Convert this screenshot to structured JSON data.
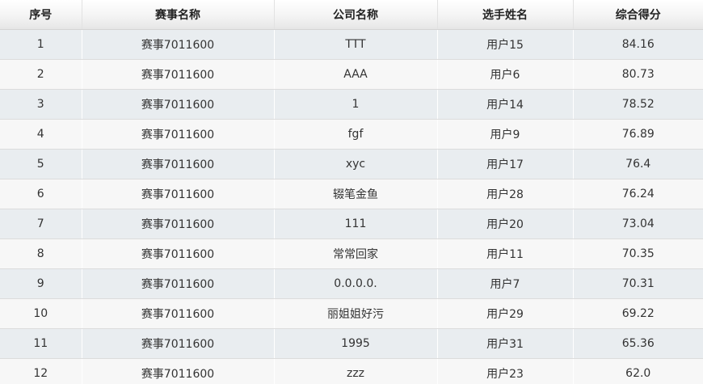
{
  "table": {
    "headers": [
      "序号",
      "赛事名称",
      "公司名称",
      "选手姓名",
      "综合得分"
    ],
    "rows": [
      [
        "1",
        "赛事7011600",
        "TTT",
        "用户15",
        "84.16"
      ],
      [
        "2",
        "赛事7011600",
        "AAA",
        "用户6",
        "80.73"
      ],
      [
        "3",
        "赛事7011600",
        "1",
        "用户14",
        "78.52"
      ],
      [
        "4",
        "赛事7011600",
        "fgf",
        "用户9",
        "76.89"
      ],
      [
        "5",
        "赛事7011600",
        "xyc",
        "用户17",
        "76.4"
      ],
      [
        "6",
        "赛事7011600",
        "辍笔金鱼",
        "用户28",
        "76.24"
      ],
      [
        "7",
        "赛事7011600",
        "111",
        "用户20",
        "73.04"
      ],
      [
        "8",
        "赛事7011600",
        "常常回家",
        "用户11",
        "70.35"
      ],
      [
        "9",
        "赛事7011600",
        "0.0.0.0.",
        "用户7",
        "70.31"
      ],
      [
        "10",
        "赛事7011600",
        "丽姐姐好污",
        "用户29",
        "69.22"
      ],
      [
        "11",
        "赛事7011600",
        "1995",
        "用户31",
        "65.36"
      ],
      [
        "12",
        "赛事7011600",
        "zzz",
        "用户23",
        "62.0"
      ]
    ]
  }
}
